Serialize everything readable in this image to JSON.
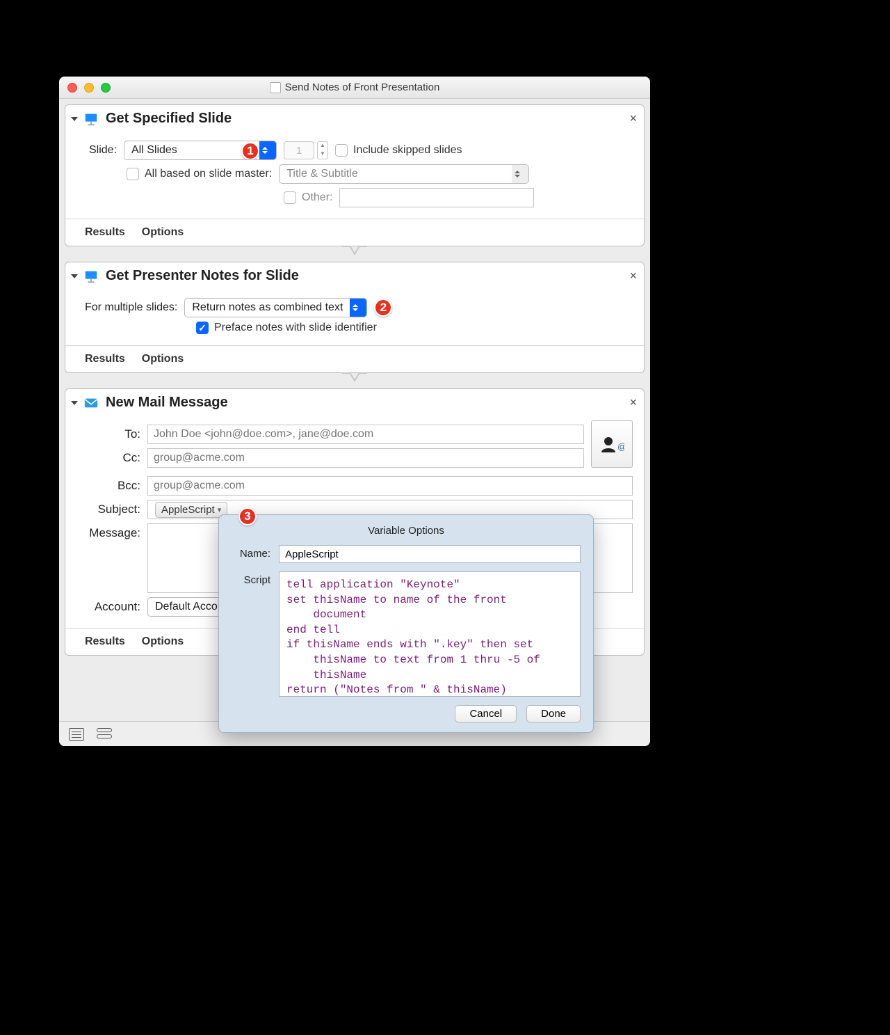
{
  "window": {
    "title": "Send Notes of Front Presentation"
  },
  "callouts": {
    "c1": "1",
    "c2": "2",
    "c3": "3"
  },
  "action1": {
    "title": "Get Specified Slide",
    "slide_label": "Slide:",
    "slide_select": "All Slides",
    "stepper_value": "1",
    "include_skipped": "Include skipped slides",
    "based_on_master": "All based on slide master:",
    "master_select": "Title & Subtitle",
    "other_label": "Other:",
    "results": "Results",
    "options": "Options"
  },
  "action2": {
    "title": "Get Presenter Notes for Slide",
    "for_multiple": "For multiple slides:",
    "notes_select": "Return notes as combined text",
    "preface": "Preface notes with slide identifier",
    "results": "Results",
    "options": "Options"
  },
  "action3": {
    "title": "New Mail Message",
    "to_label": "To:",
    "to_placeholder": "John Doe <john@doe.com>, jane@doe.com",
    "cc_label": "Cc:",
    "cc_placeholder": "group@acme.com",
    "bcc_label": "Bcc:",
    "bcc_placeholder": "group@acme.com",
    "subject_label": "Subject:",
    "subject_token": "AppleScript",
    "message_label": "Message:",
    "account_label": "Account:",
    "account_select": "Default Accou",
    "results": "Results",
    "options": "Options"
  },
  "popover": {
    "title": "Variable Options",
    "name_label": "Name:",
    "name_value": "AppleScript",
    "script_label": "Script",
    "script_text": "tell application \"Keynote\"\nset thisName to name of the front \n    document\nend tell\nif thisName ends with \".key\" then set \n    thisName to text from 1 thru -5 of \n    thisName\nreturn (\"Notes from \" & thisName)",
    "cancel": "Cancel",
    "done": "Done"
  }
}
